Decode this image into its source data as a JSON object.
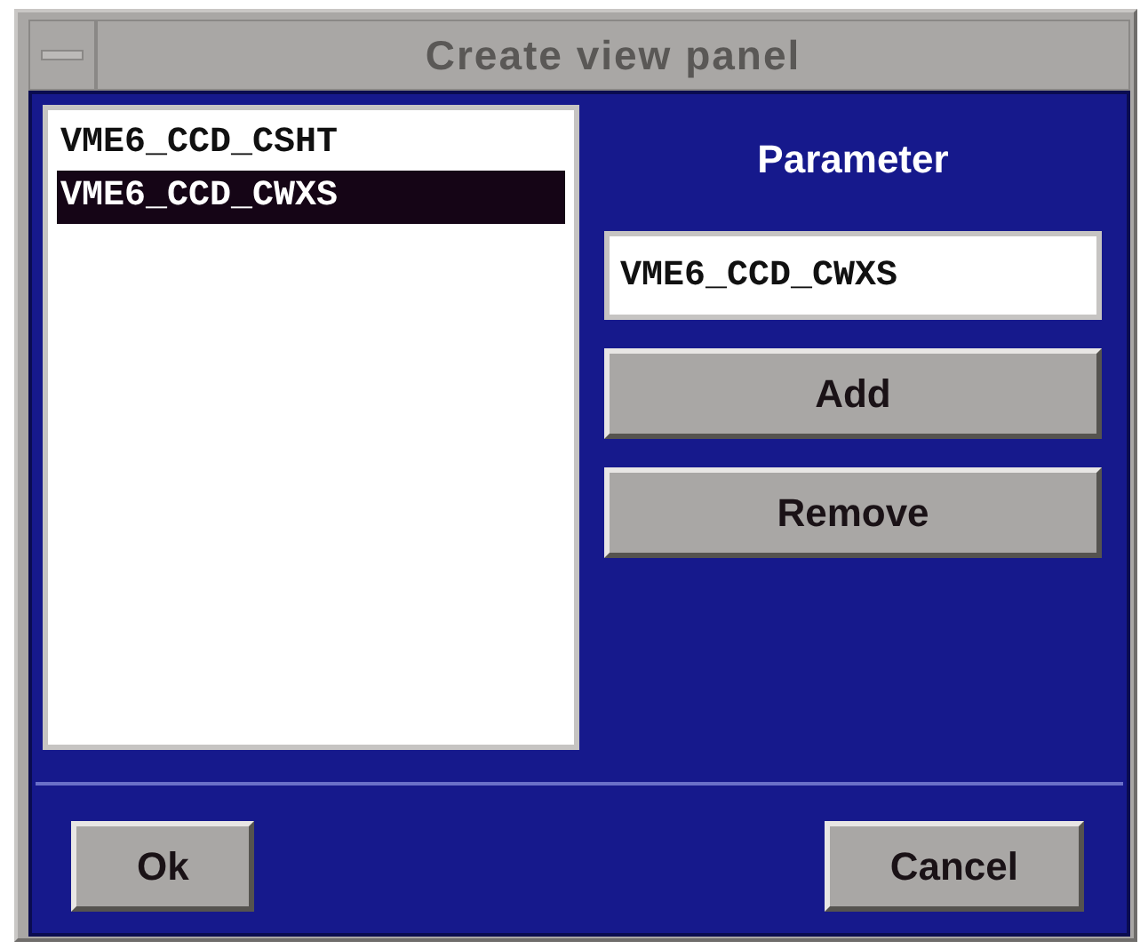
{
  "window": {
    "title": "Create view panel"
  },
  "list": {
    "items": [
      {
        "label": "VME6_CCD_CSHT",
        "selected": false
      },
      {
        "label": "VME6_CCD_CWXS",
        "selected": true
      }
    ]
  },
  "parameter": {
    "label": "Parameter",
    "value": "VME6_CCD_CWXS"
  },
  "side_buttons": [
    "Add",
    "Remove"
  ],
  "footer_buttons": [
    "Ok",
    "Cancel"
  ]
}
